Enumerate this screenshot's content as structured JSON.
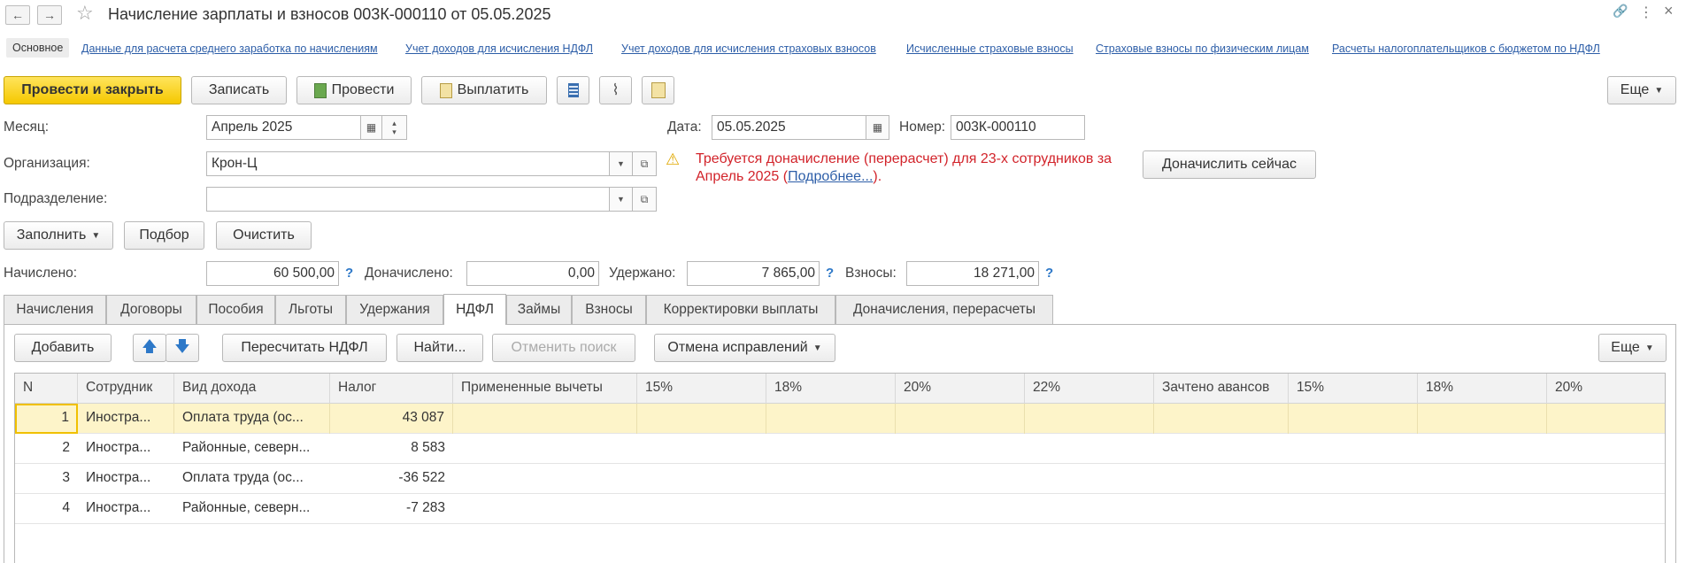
{
  "window": {
    "title": "Начисление зарплаты и взносов 003К-000110 от 05.05.2025",
    "back_glyph": "←",
    "forward_glyph": "→",
    "star_glyph": "☆",
    "link_glyph": "🔗",
    "more_glyph": "⋮",
    "close_glyph": "×"
  },
  "sections": [
    "Основное",
    "Данные для расчета среднего заработка по начислениям",
    "Учет доходов для исчисления НДФЛ",
    "Учет доходов для исчисления страховых взносов",
    "Исчисленные страховые взносы",
    "Страховые взносы по физическим лицам",
    "Расчеты налогоплательщиков с бюджетом по НДФЛ"
  ],
  "toolbar": {
    "post_close": "Провести и закрыть",
    "save": "Записать",
    "post": "Провести",
    "pay": "Выплатить",
    "more": "Еще"
  },
  "form": {
    "month_label": "Месяц:",
    "month_value": "Апрель 2025",
    "date_label": "Дата:",
    "date_value": "05.05.2025",
    "number_label": "Номер:",
    "number_value": "003К-000110",
    "org_label": "Организация:",
    "org_value": "Крон-Ц",
    "dept_label": "Подразделение:",
    "dept_value": "",
    "warning_text": "Требуется доначисление (перерасчет) для 23-х сотрудников за Апрель 2025 (",
    "warning_link": "Подробнее...",
    "warning_end": ").",
    "accrue_now": "Доначислить сейчас",
    "fill": "Заполнить",
    "pick": "Подбор",
    "clear": "Очистить"
  },
  "totals": {
    "accrued_label": "Начислено:",
    "accrued_value": "60 500,00",
    "extra_label": "Доначислено:",
    "extra_value": "0,00",
    "withheld_label": "Удержано:",
    "withheld_value": "7 865,00",
    "contrib_label": "Взносы:",
    "contrib_value": "18 271,00",
    "q": "?"
  },
  "tabs": [
    "Начисления",
    "Договоры",
    "Пособия",
    "Льготы",
    "Удержания",
    "НДФЛ",
    "Займы",
    "Взносы",
    "Корректировки выплаты",
    "Доначисления, перерасчеты"
  ],
  "active_tab": "НДФЛ",
  "tab_toolbar": {
    "add": "Добавить",
    "up_glyph": "🡅",
    "down_glyph": "🡇",
    "recalc": "Пересчитать НДФЛ",
    "find": "Найти...",
    "cancel_search": "Отменить поиск",
    "cancel_fix": "Отмена исправлений",
    "more": "Еще"
  },
  "grid": {
    "columns": [
      "N",
      "Сотрудник",
      "Вид дохода",
      "Налог",
      "Примененные вычеты",
      "15%",
      "18%",
      "20%",
      "22%",
      "Зачтено авансов",
      "15%",
      "18%",
      "20%"
    ],
    "rows": [
      {
        "n": "1",
        "employee": "Иностра...",
        "income": "Оплата труда (ос...",
        "tax": "43 087"
      },
      {
        "n": "2",
        "employee": "Иностра...",
        "income": "Районные, северн...",
        "tax": "8 583"
      },
      {
        "n": "3",
        "employee": "Иностра...",
        "income": "Оплата труда (ос...",
        "tax": "-36 522"
      },
      {
        "n": "4",
        "employee": "Иностра...",
        "income": "Районные, северн...",
        "tax": "-7 283"
      }
    ]
  },
  "colors": {
    "primary_button": "#f5c800",
    "link": "#2d5ea8",
    "warning": "#d2232a",
    "selected_row": "#fdf4c9"
  }
}
